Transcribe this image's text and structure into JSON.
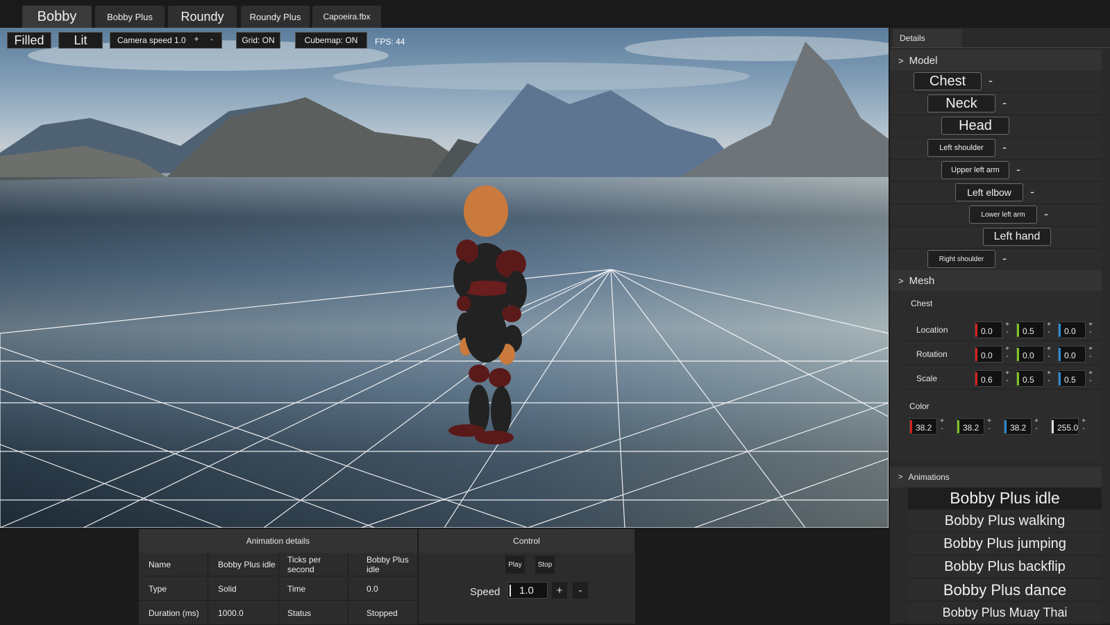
{
  "tabs": [
    {
      "label": "Bobby",
      "active": true
    },
    {
      "label": "Bobby Plus",
      "active": false
    },
    {
      "label": "Roundy",
      "active": false
    },
    {
      "label": "Roundy  Plus",
      "active": false
    },
    {
      "label": "Capoeira.fbx",
      "active": false
    }
  ],
  "viewport": {
    "filled": "Filled",
    "lit": "Lit",
    "camera_speed": "Camera speed 1.0",
    "plus": "+",
    "minus": "-",
    "grid": "Grid: ON",
    "cubemap": "Cubemap: ON",
    "fps": "FPS: 44"
  },
  "details": {
    "tab": "Details",
    "model_header": "Model",
    "bones": [
      {
        "label": "Chest"
      },
      {
        "label": "Neck"
      },
      {
        "label": "Head"
      },
      {
        "label": "Left shoulder"
      },
      {
        "label": "Upper left arm"
      },
      {
        "label": "Left elbow"
      },
      {
        "label": "Lower left arm"
      },
      {
        "label": "Left hand"
      },
      {
        "label": "Right shoulder"
      }
    ],
    "mesh_header": "Mesh",
    "mesh_name": "Chest",
    "location_label": "Location",
    "rotation_label": "Rotation",
    "scale_label": "Scale",
    "location": [
      "0.0",
      "0.5",
      "0.0"
    ],
    "rotation": [
      "0.0",
      "0.0",
      "0.0"
    ],
    "scale": [
      "0.6",
      "0.5",
      "0.5"
    ],
    "color_label": "Color",
    "color": [
      "38.2",
      "38.2",
      "38.2",
      "255.0"
    ],
    "caret": ">",
    "animations_header": "Animations",
    "animations": [
      {
        "label": "Bobby Plus idle",
        "selected": true
      },
      {
        "label": "Bobby Plus walking",
        "selected": false
      },
      {
        "label": "Bobby Plus jumping",
        "selected": false
      },
      {
        "label": "Bobby Plus backflip",
        "selected": false
      },
      {
        "label": "Bobby Plus dance",
        "selected": false
      },
      {
        "label": "Bobby Plus Muay Thai",
        "selected": false
      }
    ]
  },
  "animation_details": {
    "header": "Animation details",
    "name_label": "Name",
    "name_value": "Bobby Plus idle",
    "type_label": "Type",
    "type_value": "Solid",
    "duration_label": "Duration (ms)",
    "duration_value": "1000.0",
    "tps_label": "Ticks per second",
    "tps_value": "Bobby Plus idle",
    "time_label": "Time",
    "time_value": "0.0",
    "status_label": "Status",
    "status_value": "Stopped"
  },
  "control": {
    "header": "Control",
    "play": "Play",
    "stop": "Stop",
    "speed_label": "Speed",
    "speed_value": "1.0",
    "plus": "+",
    "minus": "-"
  },
  "colors": {
    "x_axis": "#d62020",
    "y_axis": "#7ec62a",
    "z_axis": "#2a8cd6",
    "selected_anim": "#1e1e1e"
  }
}
